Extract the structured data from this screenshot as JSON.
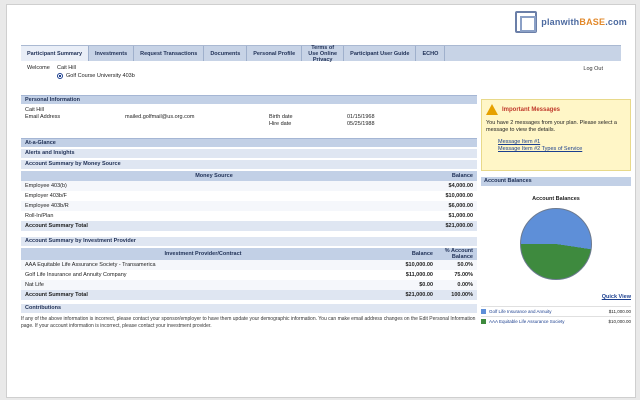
{
  "logo": {
    "text_a": "planwith",
    "text_b": "BASE",
    "text_c": ".com"
  },
  "tabs": [
    "Participant Summary",
    "Investments",
    "Request Transactions",
    "Documents",
    "Personal Profile",
    "Terms of Use Online Privacy",
    "Participant User Guide",
    "ECHO"
  ],
  "welcome": {
    "label": "Welcome",
    "name": "Cait Hill",
    "plan": "Golf Course University 403b",
    "logout": "Log Out"
  },
  "personal": {
    "heading": "Personal Information",
    "name": "Cait Hill",
    "email_label": "Email Address",
    "email_value": "mailed.golfmail@us.org.com",
    "birth_label": "Birth date",
    "birth_value": "01/15/1968",
    "hire_label": "Hire date",
    "hire_value": "05/25/1988"
  },
  "sections": {
    "at_a_glance": "At-a-Glance",
    "alerts": "Alerts and Insights",
    "contributions": "Contributions"
  },
  "money_source": {
    "title": "Account Summary by Money Source",
    "col_source": "Money Source",
    "col_balance": "Balance",
    "rows": [
      {
        "name": "Employee 403(b)",
        "value": "$4,000.00"
      },
      {
        "name": "Employer 403b/F",
        "value": "$10,000.00"
      },
      {
        "name": "Employee 403b/R",
        "value": "$6,000.00"
      },
      {
        "name": "Roll-In/Plan",
        "value": "$1,000.00"
      }
    ],
    "total_label": "Account Summary Total",
    "total_value": "$21,000.00"
  },
  "provider": {
    "title": "Account Summary by Investment Provider",
    "col_provider": "Investment Provider/Contract",
    "col_balance": "Balance",
    "col_pct": "% Account Balance",
    "rows": [
      {
        "name": "AAA Equitable Life Assurance Society - Transamerica",
        "balance": "$10,000.00",
        "pct": "50.0%"
      },
      {
        "name": "Golf Life Insurance and Annuity Company",
        "balance": "$11,000.00",
        "pct": "75.00%"
      },
      {
        "name": "Nat Life",
        "balance": "$0.00",
        "pct": "0.00%"
      }
    ],
    "total_label": "Account Summary Total",
    "total_balance": "$21,000.00",
    "total_pct": "100.00%"
  },
  "note": "If any of the above information is incorrect, please contact your sponsor/employer to have them update your demographic information. You can make email address changes on the Edit Personal Information page. If your account information is incorrect, please contact your investment provider.",
  "alerts": {
    "title": "Important Messages",
    "text": "You have 2 messages from your plan. Please select a message to view the details.",
    "items": [
      "Message Item #1",
      "Message Item #2 Types of Service"
    ]
  },
  "balance_panel": {
    "heading": "Account Balances",
    "pie_title": "Account Balances",
    "quick_link": "Quick View"
  },
  "chart_data": {
    "type": "pie",
    "title": "Account Balances",
    "slices": [
      {
        "name": "Golf Life Insurance and Annuity",
        "value": 11000.0,
        "color": "#5e8fd8"
      },
      {
        "name": "AAA Equitable Life Assurance Society",
        "value": 10000.0,
        "color": "#3e8a3e"
      }
    ]
  },
  "legend": [
    {
      "name": "Golf Life Insurance and Annuity",
      "value": "$11,000.00",
      "color": "#5e8fd8"
    },
    {
      "name": "AAA Equitable Life Assurance Society",
      "value": "$10,000.00",
      "color": "#3e8a3e"
    }
  ]
}
